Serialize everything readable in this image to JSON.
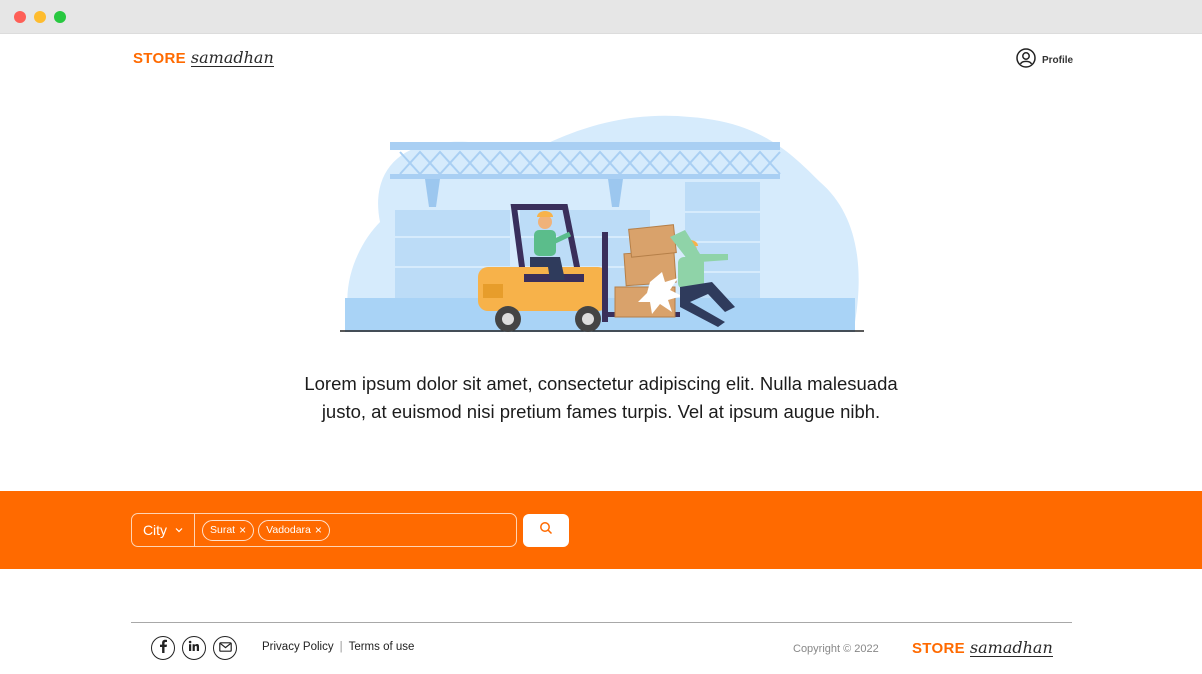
{
  "brand": {
    "store": "STORE",
    "samadhan": "samadhan"
  },
  "header": {
    "profile_label": "Profile"
  },
  "hero": {
    "text": "Lorem ipsum dolor sit amet, consectetur adipiscing elit. Nulla malesuada justo, at euismod nisi pretium fames turpis. Vel at ipsum augue nibh."
  },
  "search": {
    "city_label": "City",
    "chips": [
      "Surat",
      "Vadodara"
    ]
  },
  "footer": {
    "privacy": "Privacy Policy",
    "terms": "Terms of use",
    "separator": "|",
    "copyright": "Copyright © 2022"
  },
  "colors": {
    "accent": "#ff6a00",
    "sky": "#cfe6fb",
    "forklift": "#f7b24a"
  },
  "icons": [
    "profile-icon",
    "chevron-down-icon",
    "close-icon",
    "search-icon",
    "facebook-icon",
    "linkedin-icon",
    "mail-icon"
  ]
}
